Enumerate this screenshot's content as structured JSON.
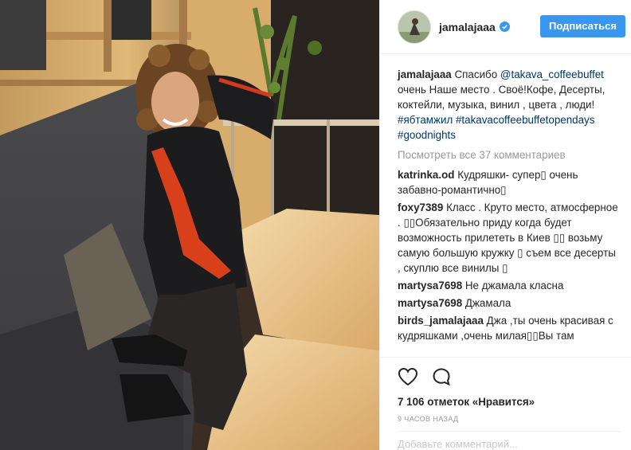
{
  "user": {
    "username": "jamalajaaa",
    "follow_label": "Подписаться"
  },
  "caption": {
    "username": "jamalajaaa",
    "text_before": "Спасибо ",
    "mention": "@takava_coffeebuffet",
    "text_after": " очень Наше место . Своё!Кофе, Десерты, коктейли, музыка, винил , цвета , люди! ",
    "hashtags": "#ябтамжил #takavacoffeebuffetopendays #goodnights"
  },
  "view_all": "Посмотреть все 37 комментариев",
  "comments": [
    {
      "user": "katrinka.od",
      "text": "Кудряшки- супер▯ очень забавно-романтично▯"
    },
    {
      "user": "foxy7389",
      "text": "Класс . Круто место, атмосферное . ▯▯Обязательно приду когда будет возможность прилететь в Киев ▯▯ возьму самую большую кружку ▯ съем все десерты , скуплю все винилы ▯"
    },
    {
      "user": "martysa7698",
      "text": "Не джамала класна"
    },
    {
      "user": "martysa7698",
      "text": "Джамала"
    },
    {
      "user": "birds_jamalajaaa",
      "text": "Джа ,ты очень красивая с кудряшками ,очень милая▯▯Вы там"
    }
  ],
  "likes": "7 106 отметок «Нравится»",
  "timestamp": "9 ЧАСОВ НАЗАД",
  "add_comment_placeholder": "Добавьте комментарий...",
  "icons": [
    "heart-icon",
    "comment-icon",
    "verified-badge-icon"
  ],
  "colors": {
    "accent": "#3897f0",
    "link": "#003569",
    "muted": "#999999"
  }
}
